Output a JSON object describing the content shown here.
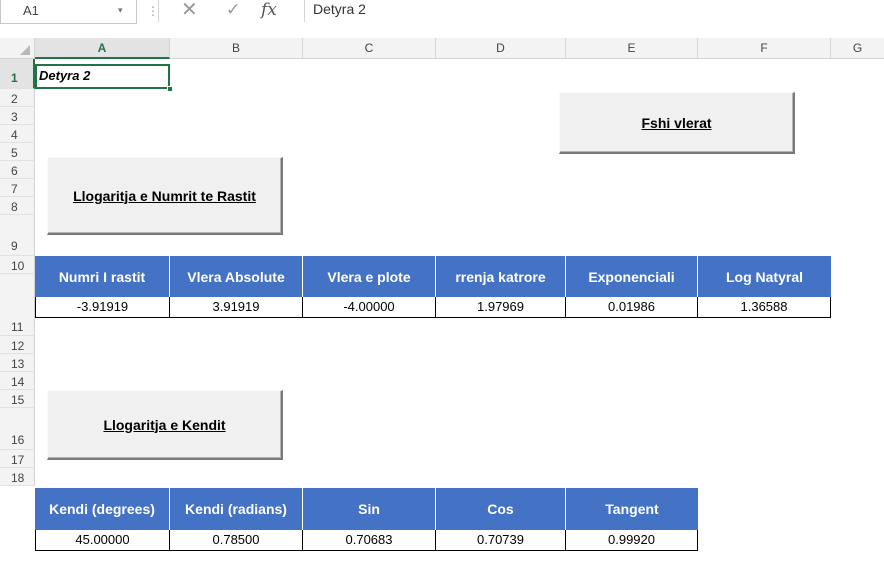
{
  "formula_bar": {
    "name_box": "A1",
    "fx_label": "fx",
    "formula": "Detyra 2"
  },
  "columns": [
    "A",
    "B",
    "C",
    "D",
    "E",
    "F",
    "G"
  ],
  "rows": [
    "1",
    "2",
    "3",
    "4",
    "5",
    "6",
    "7",
    "8",
    "9",
    "10",
    "11",
    "12",
    "13",
    "14",
    "15",
    "16",
    "17",
    "18"
  ],
  "cells": {
    "a1": "Detyra 2"
  },
  "buttons": {
    "fshi": "Fshi vlerat",
    "numri": "Llogaritja e Numrit te  Rastit",
    "kendi": "Llogaritja e Kendit"
  },
  "table_random": {
    "headers": [
      "Numri I rastit",
      "Vlera Absolute",
      "Vlera  e plote",
      "rrenja katrore",
      "Exponenciali",
      "Log Natyral"
    ],
    "values": [
      "-3.91919",
      "3.91919",
      "-4.00000",
      "1.97969",
      "0.01986",
      "1.36588"
    ]
  },
  "table_angle": {
    "headers": [
      "Kendi (degrees)",
      "Kendi (radians)",
      "Sin",
      "Cos",
      "Tangent"
    ],
    "values": [
      "45.00000",
      "0.78500",
      "0.70683",
      "0.70739",
      "0.99920"
    ]
  },
  "colors": {
    "excel_green": "#217346",
    "header_blue": "#4472c4"
  },
  "icons": [
    "cancel-icon",
    "enter-icon",
    "fx-icon"
  ]
}
